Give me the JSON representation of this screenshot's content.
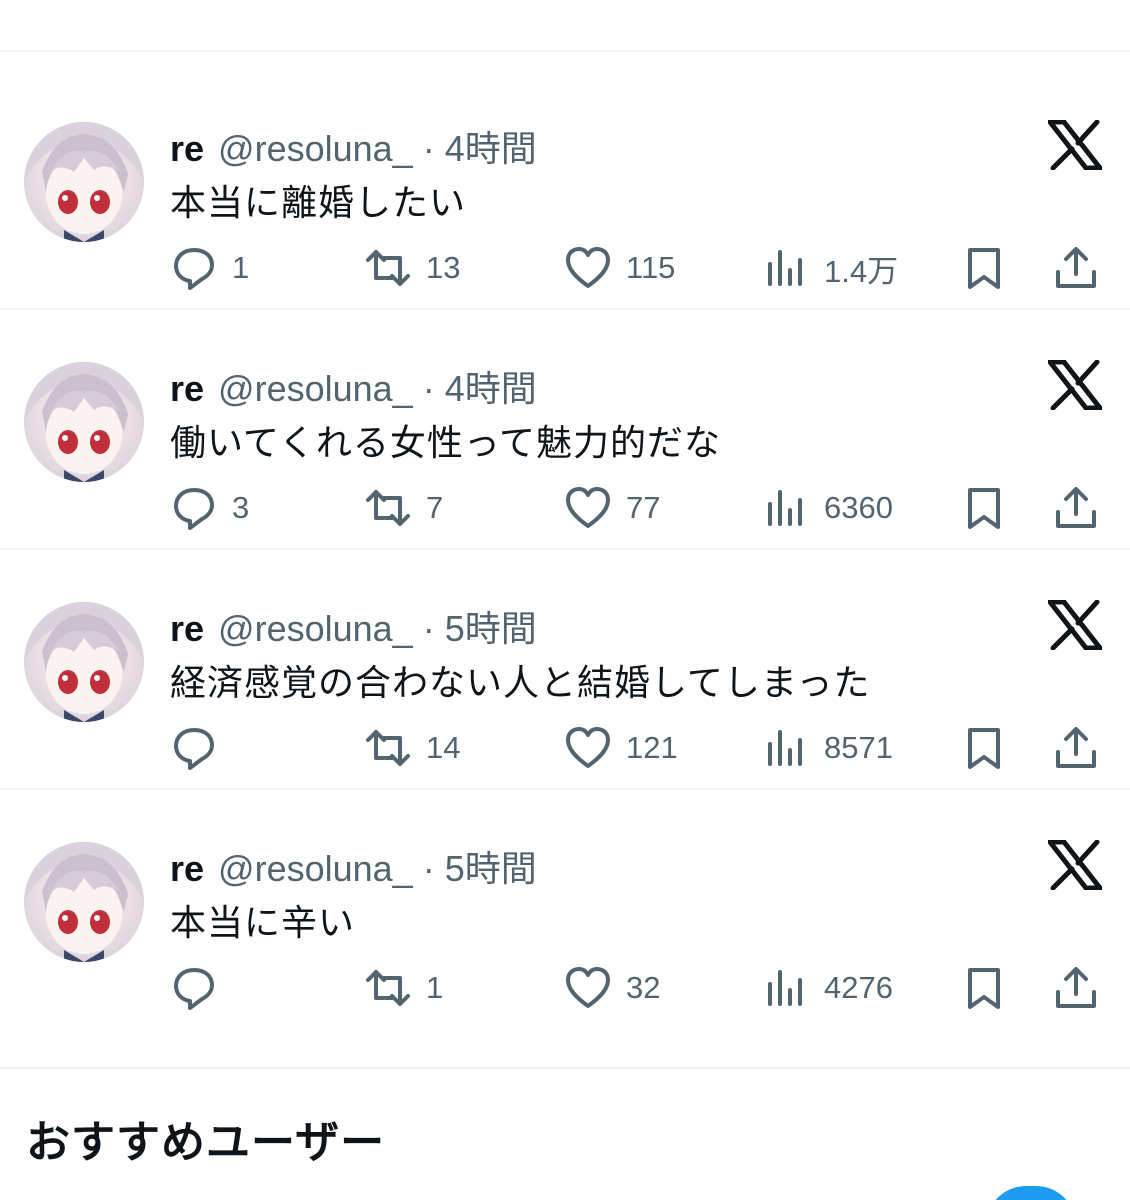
{
  "tweets": [
    {
      "name": "re",
      "handle": "@resoluna_",
      "separator": "·",
      "time": "4時間",
      "text": "本当に離婚したい",
      "replies": "1",
      "retweets": "13",
      "likes": "115",
      "views": "1.4万"
    },
    {
      "name": "re",
      "handle": "@resoluna_",
      "separator": "·",
      "time": "4時間",
      "text": "働いてくれる女性って魅力的だな",
      "replies": "3",
      "retweets": "7",
      "likes": "77",
      "views": "6360"
    },
    {
      "name": "re",
      "handle": "@resoluna_",
      "separator": "·",
      "time": "5時間",
      "text": "経済感覚の合わない人と結婚してしまった",
      "replies": "",
      "retweets": "14",
      "likes": "121",
      "views": "8571"
    },
    {
      "name": "re",
      "handle": "@resoluna_",
      "separator": "·",
      "time": "5時間",
      "text": "本当に辛い",
      "replies": "",
      "retweets": "1",
      "likes": "32",
      "views": "4276"
    }
  ],
  "suggestions": {
    "title": "おすすめユーザー"
  },
  "icons": [
    "avatar",
    "x-logo-icon",
    "reply-icon",
    "retweet-icon",
    "like-icon",
    "views-icon",
    "bookmark-icon",
    "share-icon"
  ],
  "colors": {
    "text": "#0f1419",
    "secondary": "#536471",
    "divider": "#eff3f4",
    "accent": "#1d9bf0"
  }
}
